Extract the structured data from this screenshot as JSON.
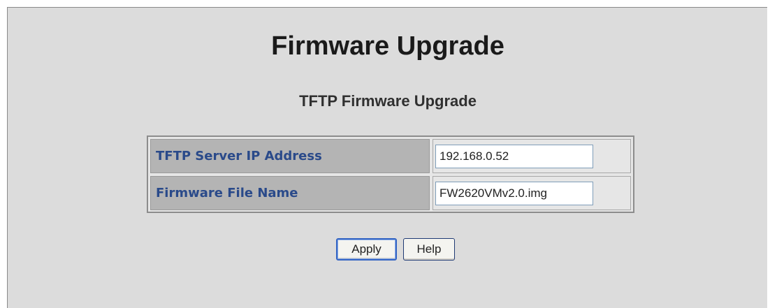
{
  "page": {
    "title": "Firmware Upgrade",
    "section_title": "TFTP Firmware Upgrade"
  },
  "form": {
    "rows": [
      {
        "label": "TFTP Server IP Address",
        "value": "192.168.0.52"
      },
      {
        "label": "Firmware File Name",
        "value": "FW2620VMv2.0.img"
      }
    ]
  },
  "buttons": {
    "apply_label": "Apply",
    "help_label": "Help"
  },
  "colors": {
    "label_text": "#2a4a8a",
    "label_background": "#b4b4b4",
    "panel_background": "#dcdcdc",
    "focus_border": "#3465c4"
  }
}
